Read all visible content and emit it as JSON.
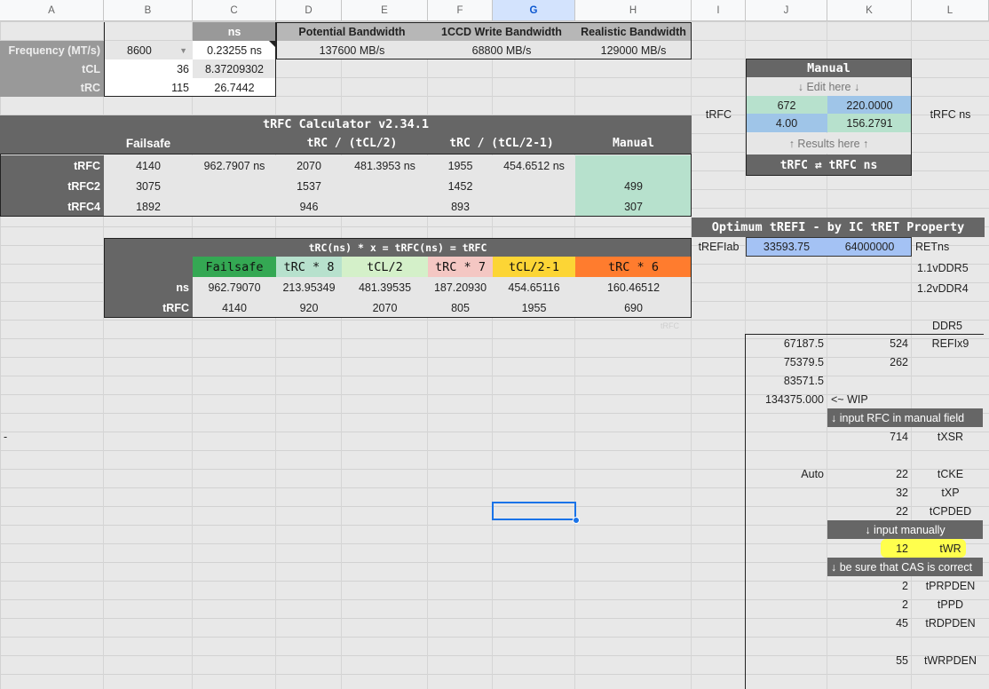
{
  "columns": [
    "A",
    "B",
    "C",
    "D",
    "E",
    "F",
    "G",
    "H",
    "I",
    "J",
    "K",
    "L"
  ],
  "top": {
    "ns_header": "ns",
    "bw_headers": [
      "Potential Bandwidth",
      "1CCD Write Bandwidth",
      "Realistic Bandwidth"
    ],
    "freq_label": "Frequency (MT/s)",
    "freq_value": "8600",
    "freq_ns": "0.23255 ns",
    "bw_values": [
      "137600 MB/s",
      "68800 MB/s",
      "129000 MB/s"
    ],
    "tcl_label": "tCL",
    "tcl_value": "36",
    "tcl_ns": "8.37209302",
    "trc_label": "tRC",
    "trc_value": "115",
    "trc_ns": "26.7442"
  },
  "calc": {
    "title": "tRFC Calculator v2.34.1",
    "headers": [
      "Failsafe",
      "tRC / (tCL/2)",
      "tRC / (tCL/2-1)",
      "Manual"
    ],
    "rows": [
      {
        "label": "tRFC",
        "failsafe": "4140",
        "failsafe_ns": "962.7907 ns",
        "v1": "2070",
        "v1_ns": "481.3953 ns",
        "v2": "1955",
        "v2_ns": "454.6512 ns",
        "manual": ""
      },
      {
        "label": "tRFC2",
        "failsafe": "3075",
        "failsafe_ns": "",
        "v1": "1537",
        "v1_ns": "",
        "v2": "1452",
        "v2_ns": "",
        "manual": "499"
      },
      {
        "label": "tRFC4",
        "failsafe": "1892",
        "failsafe_ns": "",
        "v1": "946",
        "v1_ns": "",
        "v2": "893",
        "v2_ns": "",
        "manual": "307"
      }
    ]
  },
  "formula": {
    "title": "tRC(ns) * x = tRFC(ns) = tRFC",
    "headers": [
      "Failsafe",
      "tRC * 8",
      "tCL/2",
      "tRC * 7",
      "tCL/2-1",
      "tRC * 6"
    ],
    "colors": [
      "#34a853",
      "#b7e1cd",
      "#d4f0c9",
      "#f4c7c3",
      "#fcd535",
      "#ff7c2e"
    ],
    "ns_label": "ns",
    "ns_values": [
      "962.79070",
      "213.95349",
      "481.39535",
      "187.20930",
      "454.65116",
      "160.46512"
    ],
    "trfc_label": "tRFC",
    "trfc_values": [
      "4140",
      "920",
      "2070",
      "805",
      "1955",
      "690"
    ],
    "faint": "tRFC"
  },
  "manual": {
    "title": "Manual",
    "edit_hint": "↓   Edit here   ↓",
    "row1": [
      "672",
      "220.0000"
    ],
    "row2": [
      "4.00",
      "156.2791"
    ],
    "results_hint": "↑  Results here  ↑",
    "footer": "tRFC ⇄ tRFC ns",
    "left_label": "tRFC",
    "right_label": "tRFC ns"
  },
  "trefi": {
    "title": "Optimum tREFI - by IC tRET Property",
    "label": "tREFIab",
    "val1": "33593.75",
    "val2": "64000000",
    "retns": "RETns",
    "v11": "1.1vDDR5",
    "v12": "1.2vDDR4",
    "ddr5": "DDR5"
  },
  "lower": {
    "row1": [
      "67187.5",
      "524",
      "REFIx9"
    ],
    "row2": [
      "75379.5",
      "262"
    ],
    "row3": "83571.5",
    "row4": [
      "134375.000",
      "<~ WIP"
    ],
    "hint_rfc": "↓ input RFC in manual field",
    "txsr": [
      "714",
      "tXSR"
    ],
    "dash": "-",
    "auto": "Auto",
    "tcke": [
      "22",
      "tCKE"
    ],
    "txp": [
      "32",
      "tXP"
    ],
    "tcpded": [
      "22",
      "tCPDED"
    ],
    "hint_manual": "↓ input manually",
    "twr": [
      "12",
      "tWR"
    ],
    "hint_cas": "↓ be sure that CAS is correct",
    "tprpden": [
      "2",
      "tPRPDEN"
    ],
    "tppd": [
      "2",
      "tPPD"
    ],
    "trdpden": [
      "45",
      "tRDPDEN"
    ],
    "twrpden": [
      "55",
      "tWRPDEN"
    ]
  }
}
